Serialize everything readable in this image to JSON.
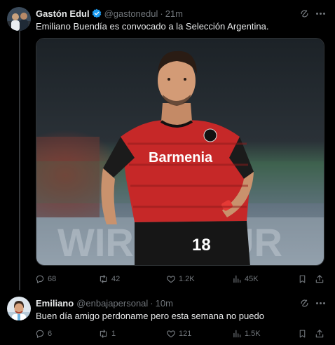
{
  "tweet": {
    "author_name": "Gastón Edul",
    "handle": "@gastonedul",
    "separator": "·",
    "time": "21m",
    "text": "Emiliano Buendía es convocado a la Selección Argentina.",
    "media": {
      "shirt_sponsor": "Barmenia",
      "shirt_number": "18",
      "description_icon": "photo"
    },
    "stats": {
      "replies": "68",
      "reposts": "42",
      "likes": "1.2K",
      "views": "45K"
    },
    "verified_color": "#1d9bf0"
  },
  "reply": {
    "author_name": "Emiliano",
    "handle": "@enbajapersonal",
    "separator": "·",
    "time": "10m",
    "text": "Buen día amigo perdoname pero esta semana no puedo",
    "stats": {
      "replies": "6",
      "reposts": "1",
      "likes": "121",
      "views": "1.5K"
    }
  },
  "icons": [
    "grok-icon",
    "more-icon",
    "reply-icon",
    "repost-icon",
    "like-icon",
    "views-icon",
    "bookmark-icon",
    "share-icon",
    "verified-badge-icon"
  ],
  "colors": {
    "background": "#000000",
    "text": "#e7e9ea",
    "muted": "#71767b",
    "jersey_red": "#d32f2f"
  }
}
